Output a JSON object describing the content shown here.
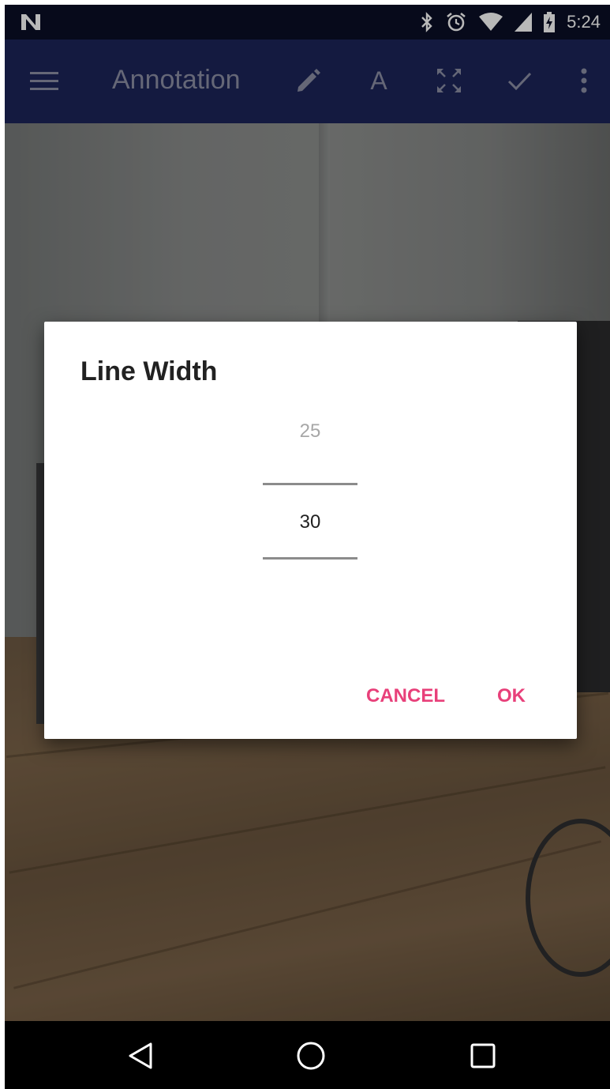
{
  "status_bar": {
    "time": "5:24",
    "icons": [
      "n-logo-icon",
      "bluetooth-icon",
      "alarm-icon",
      "wifi-icon",
      "signal-icon",
      "battery-charging-icon"
    ]
  },
  "app_bar": {
    "title": "Annotation",
    "text_tool_label": "A",
    "icons": [
      "menu-icon",
      "pencil-icon",
      "text-icon",
      "fullscreen-icon",
      "check-icon",
      "more-vert-icon"
    ]
  },
  "dialog": {
    "title": "Line Width",
    "picker": {
      "previous_value": "25",
      "current_value": "30"
    },
    "cancel_label": "CANCEL",
    "ok_label": "OK"
  },
  "nav_bar": {
    "icons": [
      "back-icon",
      "home-icon",
      "recents-icon"
    ]
  },
  "colors": {
    "status_bar": "#0b0f26",
    "app_bar": "#1c2559",
    "accent": "#e8407a",
    "dialog_bg": "#ffffff"
  }
}
